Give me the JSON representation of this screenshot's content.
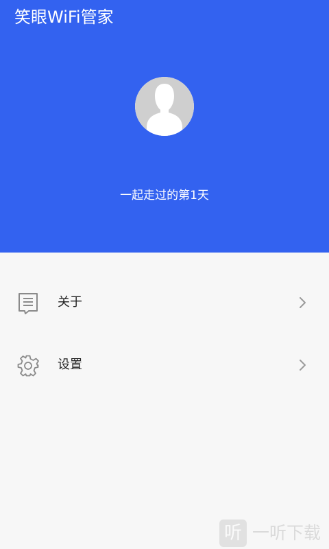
{
  "app": {
    "title": "笑眼WiFi管家"
  },
  "profile": {
    "days_text": "一起走过的第1天"
  },
  "menu": {
    "items": [
      {
        "label": "关于",
        "icon": "document-icon"
      },
      {
        "label": "设置",
        "icon": "gear-icon"
      }
    ]
  },
  "watermark": {
    "icon_glyph": "听",
    "text": "一听下载"
  },
  "colors": {
    "header_bg": "#3362f0",
    "page_bg": "#f7f7f7",
    "icon_gray": "#8a8a8a",
    "avatar_silhouette": "#cfcfcf"
  }
}
